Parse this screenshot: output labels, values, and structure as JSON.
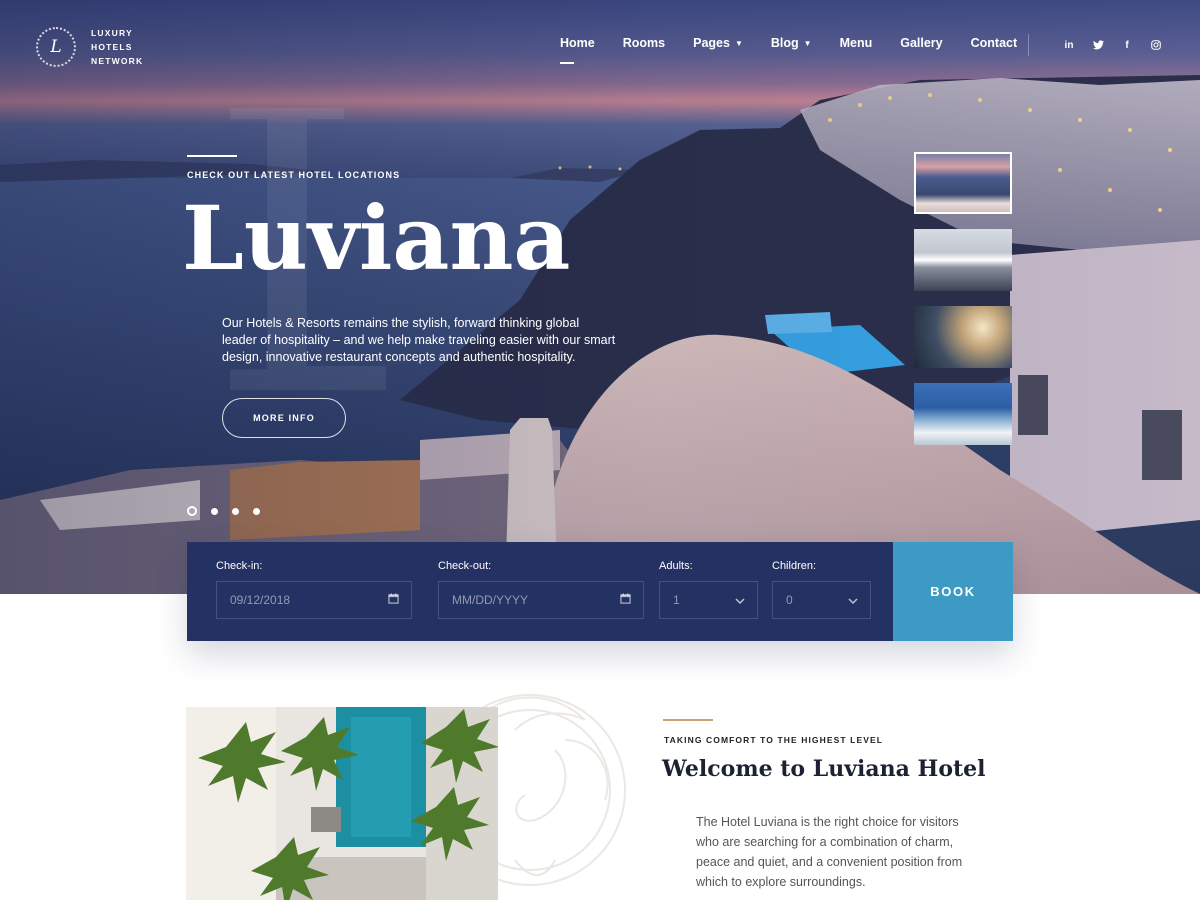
{
  "logo": {
    "monogram": "L",
    "lines": [
      "LUXURY",
      "HOTELS",
      "NETWORK"
    ]
  },
  "nav": {
    "items": [
      {
        "label": "Home",
        "active": true
      },
      {
        "label": "Rooms"
      },
      {
        "label": "Pages",
        "dropdown": true
      },
      {
        "label": "Blog",
        "dropdown": true
      },
      {
        "label": "Menu"
      },
      {
        "label": "Gallery"
      },
      {
        "label": "Contact"
      }
    ],
    "social": [
      {
        "icon": "linkedin-icon",
        "glyph": "in"
      },
      {
        "icon": "twitter-icon",
        "glyph": "🐦"
      },
      {
        "icon": "facebook-icon",
        "glyph": "f"
      },
      {
        "icon": "instagram-icon",
        "glyph": "◎"
      }
    ]
  },
  "hero": {
    "big_letter": "L",
    "eyebrow": "CHECK OUT LATEST HOTEL LOCATIONS",
    "title": "Luviana",
    "description": "Our Hotels & Resorts remains the stylish, forward thinking global leader of hospitality – and we help make traveling easier with our smart design, innovative restaurant concepts and authentic hospitality.",
    "cta": "MORE INFO",
    "slides": 4,
    "active_slide": 1
  },
  "booking": {
    "checkin": {
      "label": "Check-in:",
      "value": "09/12/2018",
      "icon": "calendar-icon"
    },
    "checkout": {
      "label": "Check-out:",
      "value": "MM/DD/YYYY",
      "icon": "calendar-icon"
    },
    "adults": {
      "label": "Adults:",
      "value": "1",
      "icon": "chevron-down-icon"
    },
    "children": {
      "label": "Children:",
      "value": "0",
      "icon": "chevron-down-icon"
    },
    "button": "BOOK"
  },
  "about": {
    "eyebrow": "TAKING COMFORT TO THE HIGHEST LEVEL",
    "title": "Welcome to Luviana Hotel",
    "text": "The Hotel Luviana is the right choice for visitors who are searching for a combination of charm, peace and quiet, and a convenient position from which to explore surroundings."
  },
  "colors": {
    "booking_bg": "#243163",
    "book_button": "#3d9ac4",
    "accent_line": "#c4a472"
  }
}
